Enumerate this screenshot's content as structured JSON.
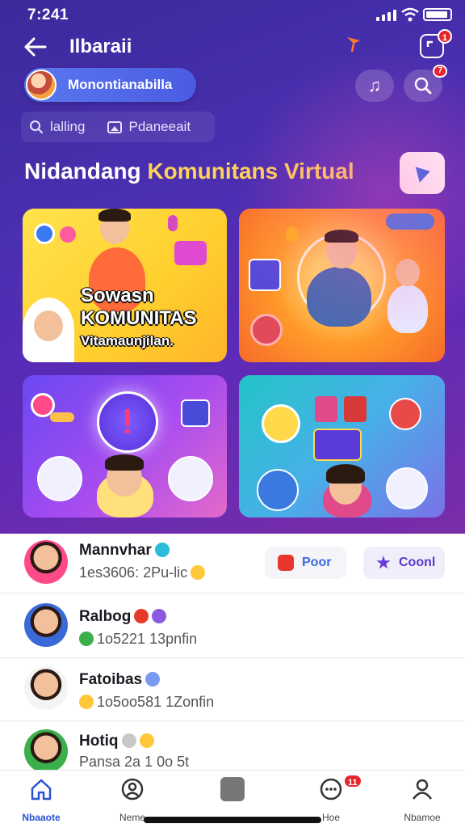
{
  "status_bar": {
    "time": "7:241"
  },
  "header": {
    "title": "Ilbaraii",
    "share_badge": "1",
    "search_badge": "7"
  },
  "community": {
    "name": "Monontianabilla"
  },
  "filters": [
    {
      "label": "lalling"
    },
    {
      "label": "Pdaneeait"
    }
  ],
  "section": {
    "title_part1": "Nidandang ",
    "title_highlight": "Komunitans Virtual"
  },
  "cards": [
    {
      "line1": "Sowasn",
      "line2": "KOMUNITAS",
      "line3": "Vitamaunjilan."
    },
    {},
    {
      "center_symbol": "!"
    },
    {}
  ],
  "members": [
    {
      "name": "Mannvhar",
      "meta": "1es3606: 2Pu-lic",
      "chips": [
        {
          "label": "Poor"
        },
        {
          "label": "Coonl"
        }
      ]
    },
    {
      "name": "Ralbog",
      "meta": "1o5221 13pnfin"
    },
    {
      "name": "Fatoibas",
      "meta": "1o5oo581 1Zonfin"
    },
    {
      "name": "Hotiq",
      "meta": "Pansa 2a 1 0o 5t"
    }
  ],
  "tabbar": [
    {
      "label": "Nbaaote"
    },
    {
      "label": "Neme"
    },
    {
      "label": ""
    },
    {
      "label": "Hoe",
      "badge": "11"
    },
    {
      "label": "Nbamoe"
    }
  ],
  "colors": {
    "accent": "#2a52d6",
    "hero_start": "#3b2a9c",
    "hero_end": "#7a2da8",
    "highlight": "#ffd25a",
    "badge": "#e5262e"
  }
}
